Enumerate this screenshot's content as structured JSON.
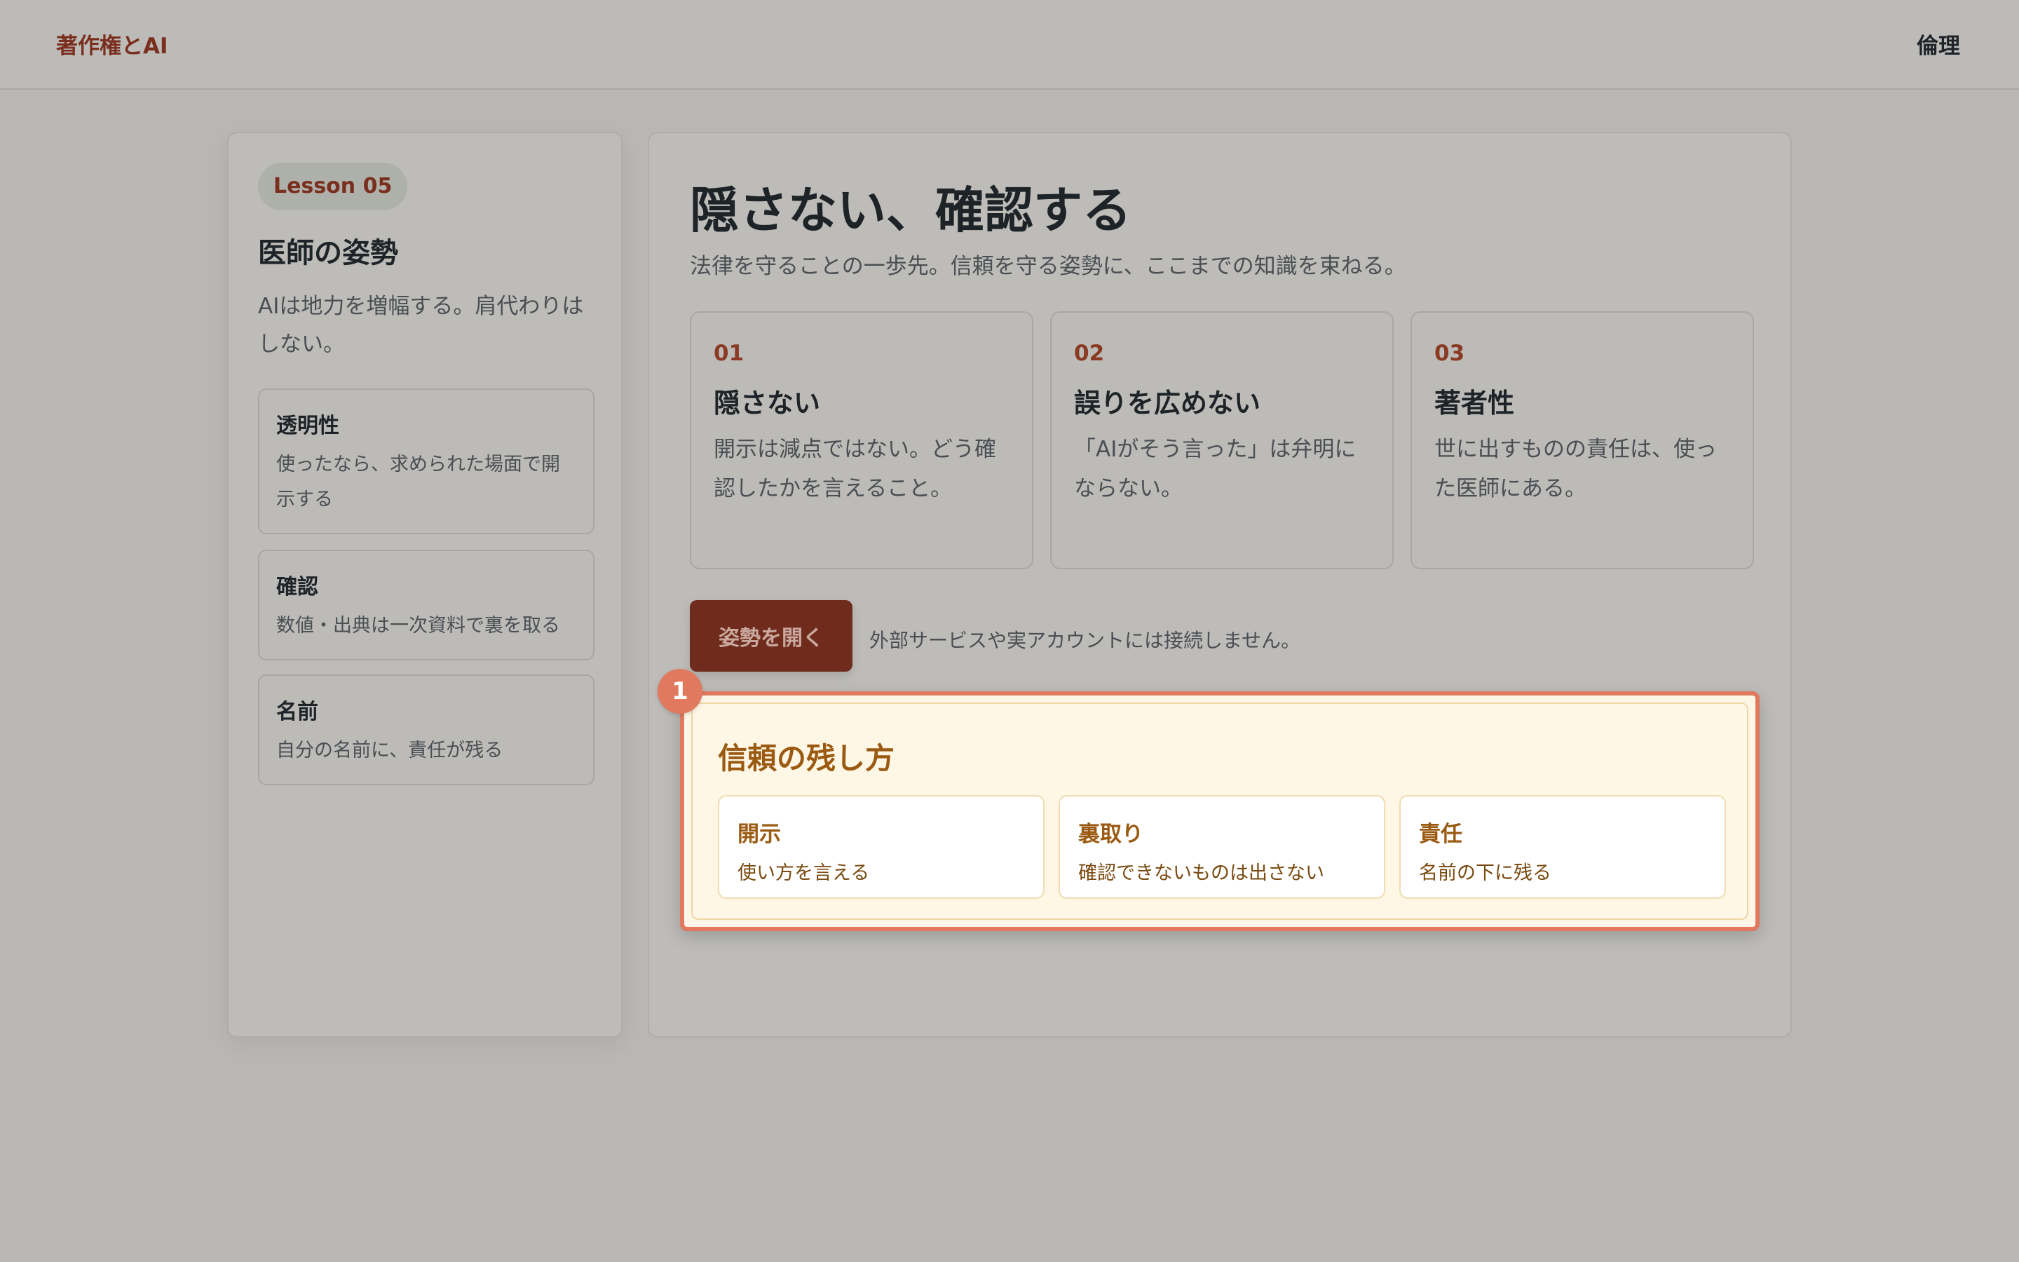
{
  "header": {
    "brand": "著作権とAI",
    "nav_label": "倫理"
  },
  "sidebar": {
    "lesson_label": "Lesson 05",
    "title": "医師の姿勢",
    "description": "AIは地力を増幅する。肩代わりはしない。",
    "cards": [
      {
        "title": "透明性",
        "text": "使ったなら、求められた場面で開示する"
      },
      {
        "title": "確認",
        "text": "数値・出典は一次資料で裏を取る"
      },
      {
        "title": "名前",
        "text": "自分の名前に、責任が残る"
      }
    ]
  },
  "main": {
    "title": "隠さない、確認する",
    "subtitle": "法律を守ることの一歩先。信頼を守る姿勢に、ここまでの知識を束ねる。",
    "steps": [
      {
        "num": "01",
        "title": "隠さない",
        "text": "開示は減点ではない。どう確認したかを言えること。"
      },
      {
        "num": "02",
        "title": "誤りを広めない",
        "text": "「AIがそう言った」は弁明にならない。"
      },
      {
        "num": "03",
        "title": "著者性",
        "text": "世に出すものの責任は、使った医師にある。"
      }
    ],
    "button_label": "姿勢を開く",
    "button_note": "外部サービスや実アカウントには接続しません。"
  },
  "reveal": {
    "badge": "1",
    "title": "信頼の残し方",
    "items": [
      {
        "title": "開示",
        "text": "使い方を言える"
      },
      {
        "title": "裏取り",
        "text": "確認できないものは出さない"
      },
      {
        "title": "責任",
        "text": "名前の下に残る"
      }
    ]
  },
  "colors": {
    "accent": "#7a2e1e",
    "highlight": "#e0795d",
    "reveal_text": "#9a5a12"
  }
}
